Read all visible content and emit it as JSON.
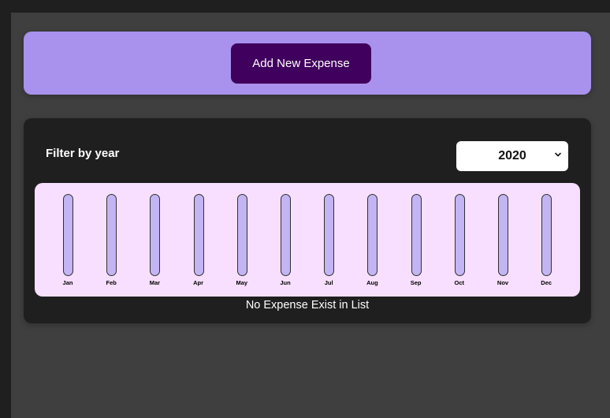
{
  "new_expense": {
    "add_button_label": "Add New Expense"
  },
  "filter": {
    "label": "Filter by year",
    "selected_year": "2020"
  },
  "chart_data": {
    "type": "bar",
    "categories": [
      "Jan",
      "Feb",
      "Mar",
      "Apr",
      "May",
      "Jun",
      "Jul",
      "Aug",
      "Sep",
      "Oct",
      "Nov",
      "Dec"
    ],
    "values": [
      0,
      0,
      0,
      0,
      0,
      0,
      0,
      0,
      0,
      0,
      0,
      0
    ]
  },
  "list": {
    "empty_message": "No Expense Exist in List"
  },
  "colors": {
    "page_background": "#1f1f1f",
    "frame_background": "#3f3f3f",
    "new_expense_panel": "#a892ee",
    "add_button": "#40005d",
    "expenses_panel": "#1f1f1f",
    "chart_background": "#f8dfff",
    "bar_track": "#c3b4f3",
    "bar_fill": "#4826b9"
  }
}
